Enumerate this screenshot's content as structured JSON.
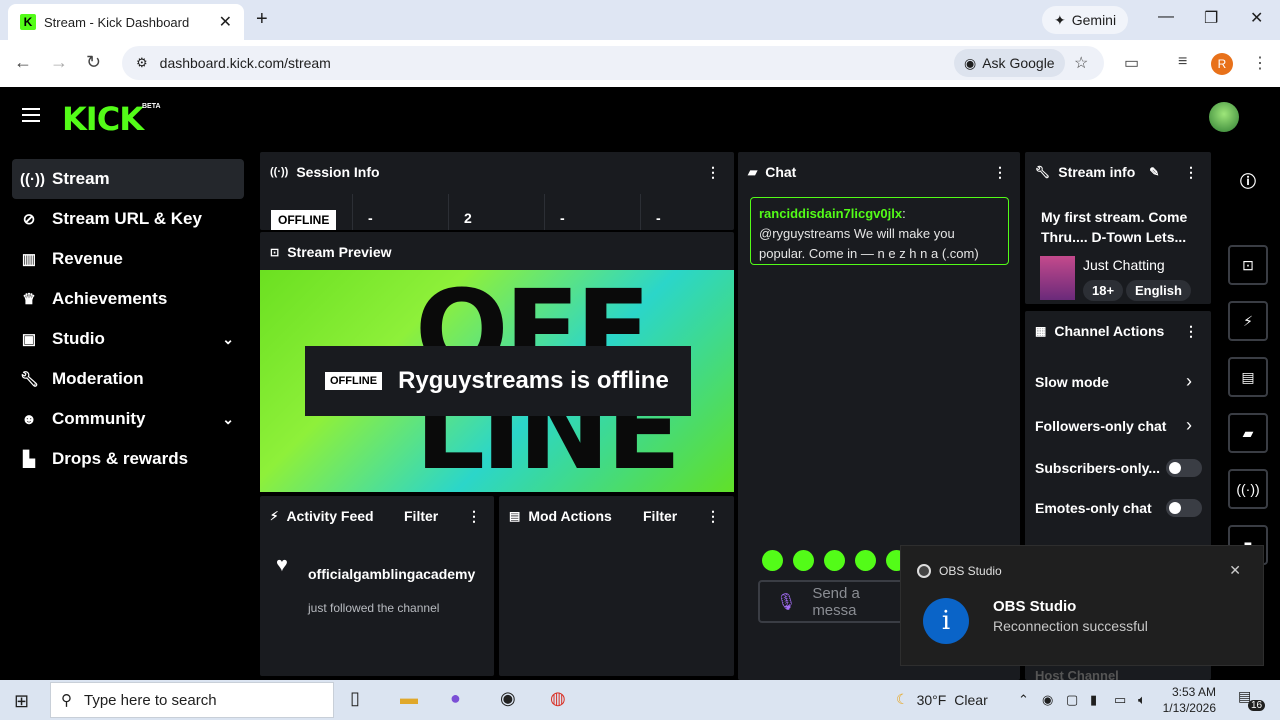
{
  "browser": {
    "tab_title": "Stream - Kick Dashboard",
    "tab_close": "✕",
    "new_tab": "+",
    "gemini_label": "Gemini",
    "url": "dashboard.kick.com/stream",
    "ask_google": "Ask Google",
    "profile_initial": "R"
  },
  "header": {
    "logo": "KICK",
    "beta": "BETA"
  },
  "sidebar": {
    "items": [
      {
        "label": "Stream",
        "icon": "broadcast-icon"
      },
      {
        "label": "Stream URL & Key",
        "icon": "link-icon"
      },
      {
        "label": "Revenue",
        "icon": "chart-icon"
      },
      {
        "label": "Achievements",
        "icon": "trophy-icon"
      },
      {
        "label": "Studio",
        "icon": "studio-icon"
      },
      {
        "label": "Moderation",
        "icon": "wrench-icon"
      },
      {
        "label": "Community",
        "icon": "people-icon"
      },
      {
        "label": "Drops & rewards",
        "icon": "drops-icon"
      }
    ]
  },
  "session": {
    "title": "Session Info",
    "status": "OFFLINE",
    "stats": [
      "-",
      "2",
      "-",
      "-"
    ]
  },
  "preview": {
    "title": "Stream Preview",
    "bg_text": "OFF LINE",
    "badge": "OFFLINE",
    "message": "Ryguystreams is offline"
  },
  "activity": {
    "title": "Activity Feed",
    "filter": "Filter",
    "item_user": "officialgamblingacademy",
    "item_text": "just followed the channel"
  },
  "mod_actions": {
    "title": "Mod Actions",
    "filter": "Filter"
  },
  "chat": {
    "title": "Chat",
    "message_user": "ranciddisdain7licgv0jlx",
    "message_text": "@ryguystreams We will make you popular. Come in — n e z h n a (.com)",
    "input_placeholder": "Send a messa"
  },
  "stream_info": {
    "title": "Stream info",
    "stream_title": "My first stream. Come Thru.... D-Town Lets...",
    "category": "Just Chatting",
    "tags": [
      "18+",
      "English"
    ]
  },
  "channel_actions": {
    "title": "Channel Actions",
    "rows": [
      "Slow mode",
      "Followers-only chat",
      "Subscribers-only...",
      "Emotes-only chat"
    ],
    "cutoff": "Host Channel"
  },
  "toast": {
    "app": "OBS Studio",
    "title": "OBS Studio",
    "message": "Reconnection successful"
  },
  "taskbar": {
    "search_placeholder": "Type here to search",
    "weather_temp": "30°F",
    "weather_desc": "Clear",
    "time": "3:53 AM",
    "date": "1/13/2026",
    "notif_count": "16"
  },
  "colors": {
    "kick_green": "#53fc18",
    "panel": "#191b1f",
    "active_side": "#24272c"
  }
}
